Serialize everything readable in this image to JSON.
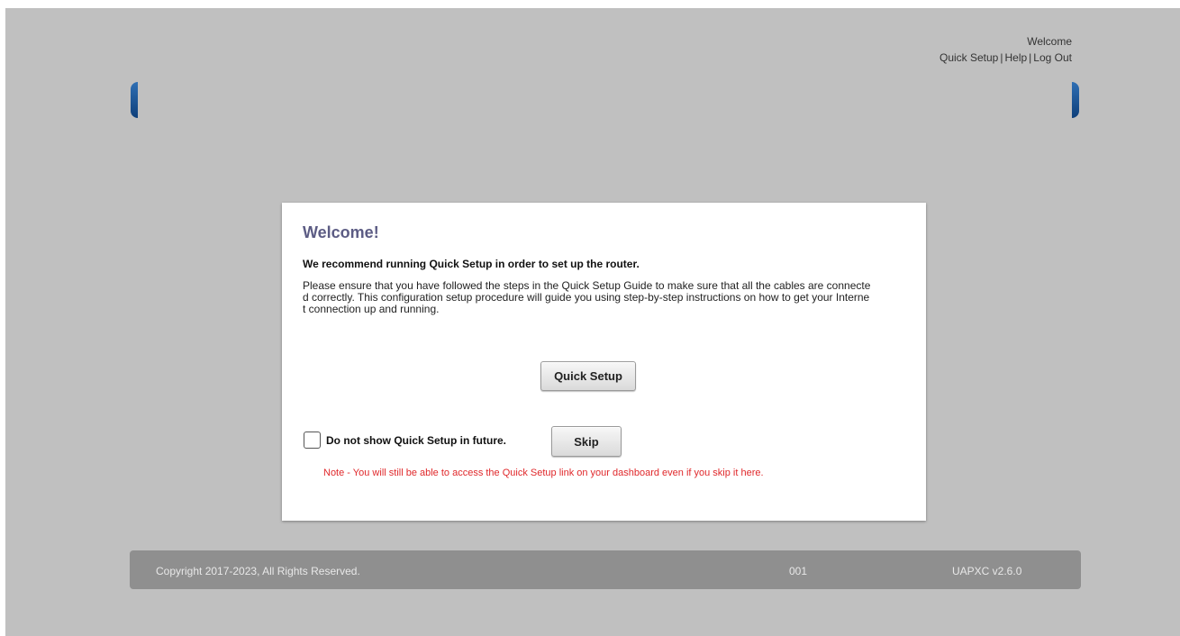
{
  "header": {
    "welcome": "Welcome",
    "links": [
      "Quick Setup",
      "Help",
      "Log Out"
    ],
    "separator": "|"
  },
  "dialog": {
    "title": "Welcome!",
    "recommendation": "We recommend running Quick Setup in order to set up the router.",
    "description": "Please ensure that you have followed the steps in the Quick Setup Guide to make sure that all the cables are connected correctly. This configuration setup procedure will guide you using step-by-step instructions on how to get your Internet connection up and running.",
    "quick_setup_button": "Quick Setup",
    "checkbox_label": "Do not show Quick Setup in future.",
    "checkbox_checked": false,
    "skip_button": "Skip",
    "note": "Note - You will still be able to access the Quick Setup link on your dashboard even if you skip it here."
  },
  "footer": {
    "copyright": "Copyright 2017-2023, All Rights Reserved.",
    "code": "001",
    "version": "UAPXC v2.6.0"
  },
  "colors": {
    "background": "#c0c0c0",
    "title": "#5c5c84",
    "note": "#e0282b",
    "footer": "#8f8f8f",
    "bracket": "#1f5a9c"
  }
}
